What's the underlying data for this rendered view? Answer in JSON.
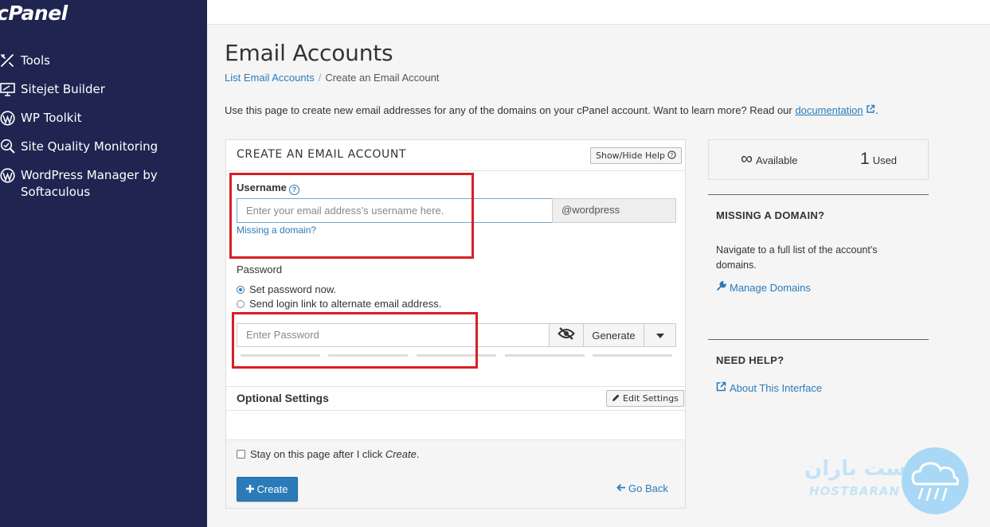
{
  "brand": {
    "logo_text": "cPanel",
    "sidebar_bg": "#1f2550",
    "accent": "#2b7bb9",
    "highlight": "#d81f26"
  },
  "sidebar": {
    "items": [
      {
        "label": "Tools",
        "icon": "tools-icon"
      },
      {
        "label": "Sitejet Builder",
        "icon": "monitor-icon"
      },
      {
        "label": "WP Toolkit",
        "icon": "wordpress-icon"
      },
      {
        "label": "Site Quality Monitoring",
        "icon": "magnifier-icon"
      },
      {
        "label": "WordPress Manager by Softaculous",
        "icon": "wordpress-icon"
      }
    ]
  },
  "page": {
    "title": "Email Accounts",
    "breadcrumb": {
      "parent": "List Email Accounts",
      "separator": "/",
      "current": "Create an Email Account"
    },
    "intro": {
      "text": "Use this page to create new email addresses for any of the domains on your cPanel account. Want to learn more? Read our ",
      "link": "documentation",
      "tail": "."
    }
  },
  "form": {
    "title": "CREATE AN EMAIL ACCOUNT",
    "show_hide_help": "Show/Hide Help",
    "username": {
      "label": "Username",
      "placeholder": "Enter your email address’s username here.",
      "domain": "@wordpress",
      "missing_link": "Missing a domain?"
    },
    "password": {
      "label": "Password",
      "option_set": "Set password now.",
      "option_link": "Send login link to alternate email address.",
      "placeholder": "Enter Password",
      "generate": "Generate"
    },
    "optional": {
      "label": "Optional Settings",
      "edit": "Edit Settings"
    },
    "stay": {
      "text": "Stay on this page after I click ",
      "em": "Create",
      "tail": "."
    },
    "create": "Create",
    "go_back": "Go Back"
  },
  "right": {
    "available_value": "∞",
    "available_label": "Available",
    "used_value": "1",
    "used_label": "Used",
    "missing_domain": {
      "heading": "MISSING A DOMAIN?",
      "text": "Navigate to a full list of the account’s domains.",
      "link": "Manage Domains"
    },
    "need_help": {
      "heading": "NEED HELP?",
      "link": "About This Interface"
    }
  },
  "watermark": {
    "arabic": "هاست باران",
    "latin": "HOSTBARAN"
  }
}
